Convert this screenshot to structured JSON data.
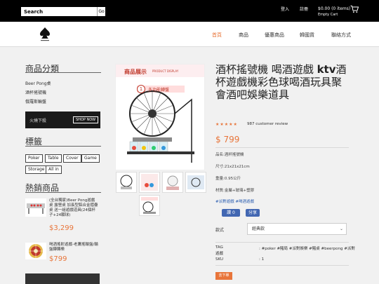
{
  "topbar": {
    "search_value": "Search",
    "search_button": "Go",
    "login": "登入",
    "register": "註冊",
    "cart_total": "$0.00 (0 items)",
    "cart_empty": "Empty Cart"
  },
  "nav": {
    "items": [
      "首頁",
      "商品",
      "優惠商品",
      "韓國貨",
      "聯絡方式"
    ]
  },
  "sidebar": {
    "categories_title": "商品分類",
    "categories": [
      "Beer Pong桌",
      "酒杯搖號機",
      "俄羅斯輪盤"
    ],
    "banner_text": "火燒下殺",
    "banner_button": "SHOP NOW",
    "tags_title": "標籤",
    "tags": [
      "Poker",
      "Table",
      "Cover",
      "Game",
      "Storage",
      "All in"
    ],
    "hot_title": "熱銷商品",
    "hot_items": [
      {
        "title": "(全台獨家)Beer Pong遊戲桌 露營桌 加長型鋁合金摺疊桌 送一組遊戲道具(24個杯子+24顆球)",
        "price": "$3,299"
      },
      {
        "title": "喝酒搖射遊戲-老鷹搖輪盤/輪盤轉轉樂",
        "price": "$799"
      }
    ]
  },
  "product": {
    "image_banner": "商品展示",
    "image_banner_en": "PRODUCT DISPLAY",
    "image_number": "1",
    "image_caption": "多功能轉盤",
    "title_1": "酒杯搖號機 喝酒遊戲",
    "title_latin": "ktv",
    "title_2": "酒杯遊戲機彩色球喝酒玩具聚會酒吧娛樂道具",
    "stars": "★★★★★",
    "reviews": "987 customer review",
    "price": "$ 799",
    "specs": [
      "品名:酒杯搖號機",
      "尺寸:21x21x21cm",
      "重量:0.95公斤",
      "材質:金屬+玻璃+塑膠"
    ],
    "hashtags": "#派對遊戲 #喝酒遊戲",
    "fb_like": "讚 0",
    "fb_share": "分享",
    "option_label": "款式",
    "option_value": "經典款",
    "tag_label": "TAG",
    "tag_sub": "遊戲",
    "tag_value": ": #poker #賭局 #派對娛樂 #賭桌 #beerpong #派對",
    "sku_label": "SKU",
    "sku_value": ": 1",
    "order_button": "去下單"
  },
  "colors": {
    "accent": "#e8753a",
    "topbar": "#000000",
    "fb": "#4267b2"
  }
}
